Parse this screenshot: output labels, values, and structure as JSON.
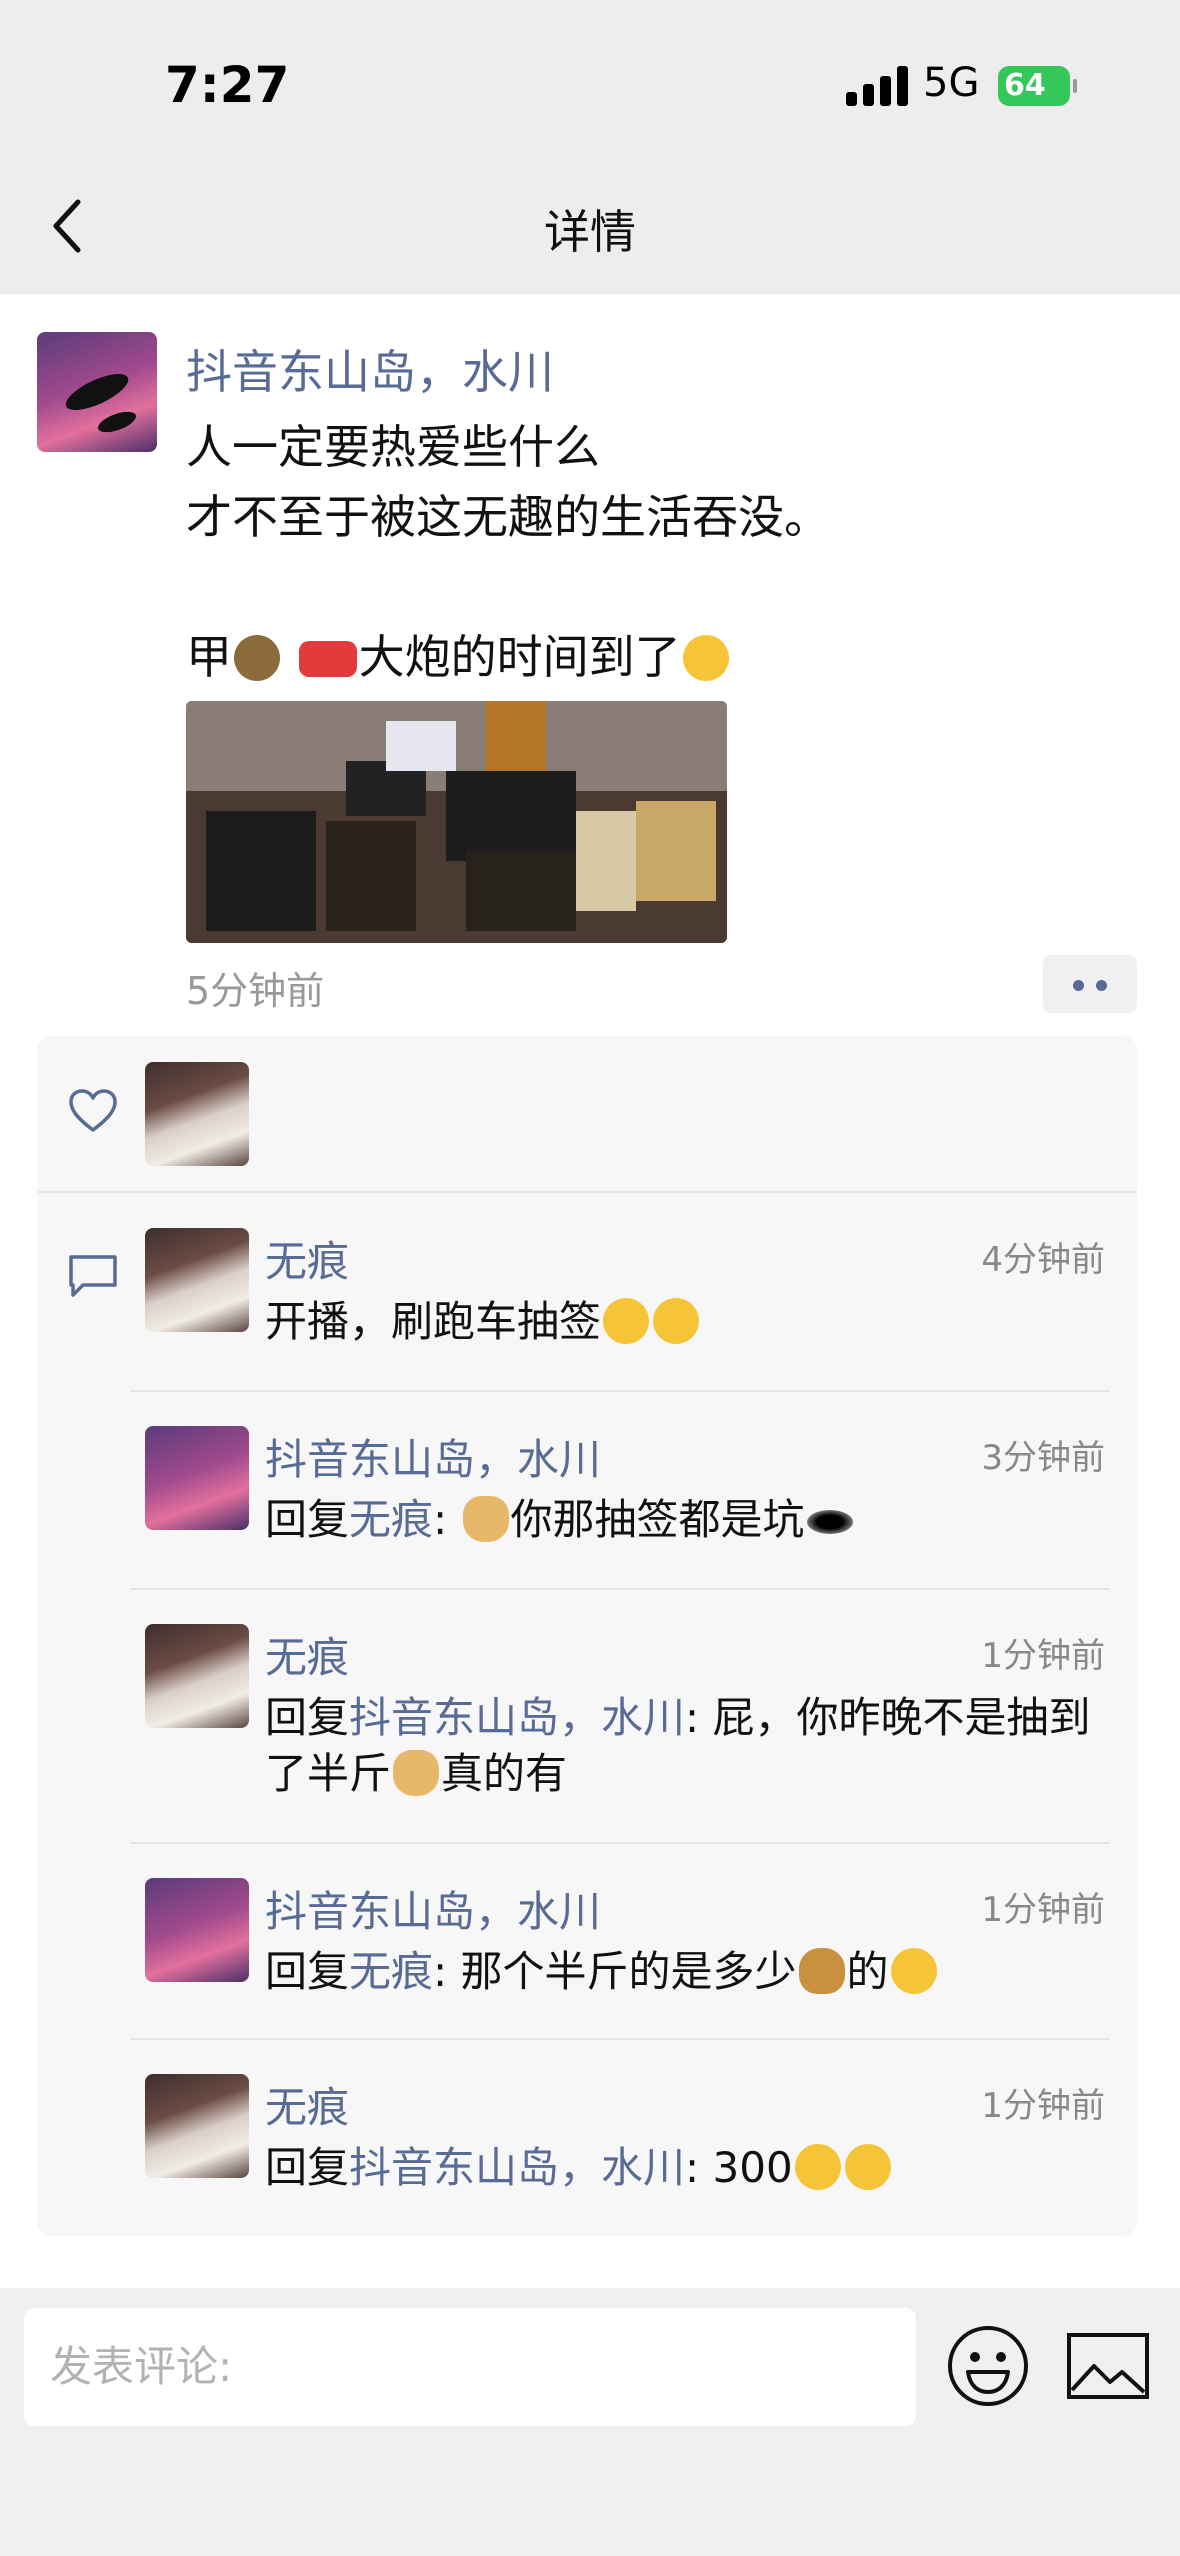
{
  "status_bar": {
    "time": "7:27",
    "network": "5G",
    "battery": "64"
  },
  "nav": {
    "title": "详情",
    "back_icon": "chevron-left-icon"
  },
  "post": {
    "author": "抖音东山岛，水川",
    "text_line1": "人一定要热爱些什么",
    "text_line2": "才不至于被这无趣的生活吞没。",
    "text_line3": "甲",
    "text_line3b": "大炮的时间到了",
    "time": "5分钟前"
  },
  "comments": [
    {
      "name": "无痕",
      "time": "4分钟前",
      "prefix": "",
      "reply_to": "",
      "content": "开播，刷跑车抽签"
    },
    {
      "name": "抖音东山岛，水川",
      "time": "3分钟前",
      "prefix": "回复",
      "reply_to": "无痕",
      "content": ": ",
      "content2": "你那抽签都是坑"
    },
    {
      "name": "无痕",
      "time": "1分钟前",
      "prefix": "回复",
      "reply_to": "抖音东山岛，水川",
      "content": ": 屁，你昨晚不是抽到了半斤",
      "content2": "真的有"
    },
    {
      "name": "抖音东山岛，水川",
      "time": "1分钟前",
      "prefix": "回复",
      "reply_to": "无痕",
      "content": ": 那个半斤的是多少",
      "content2": "的"
    },
    {
      "name": "无痕",
      "time": "1分钟前",
      "prefix": "回复",
      "reply_to": "抖音东山岛，水川",
      "content": ": 300"
    }
  ],
  "input": {
    "placeholder": "发表评论:"
  },
  "colors": {
    "link": "#576b95",
    "battery": "#34c759",
    "panel": "#f7f7f7"
  }
}
